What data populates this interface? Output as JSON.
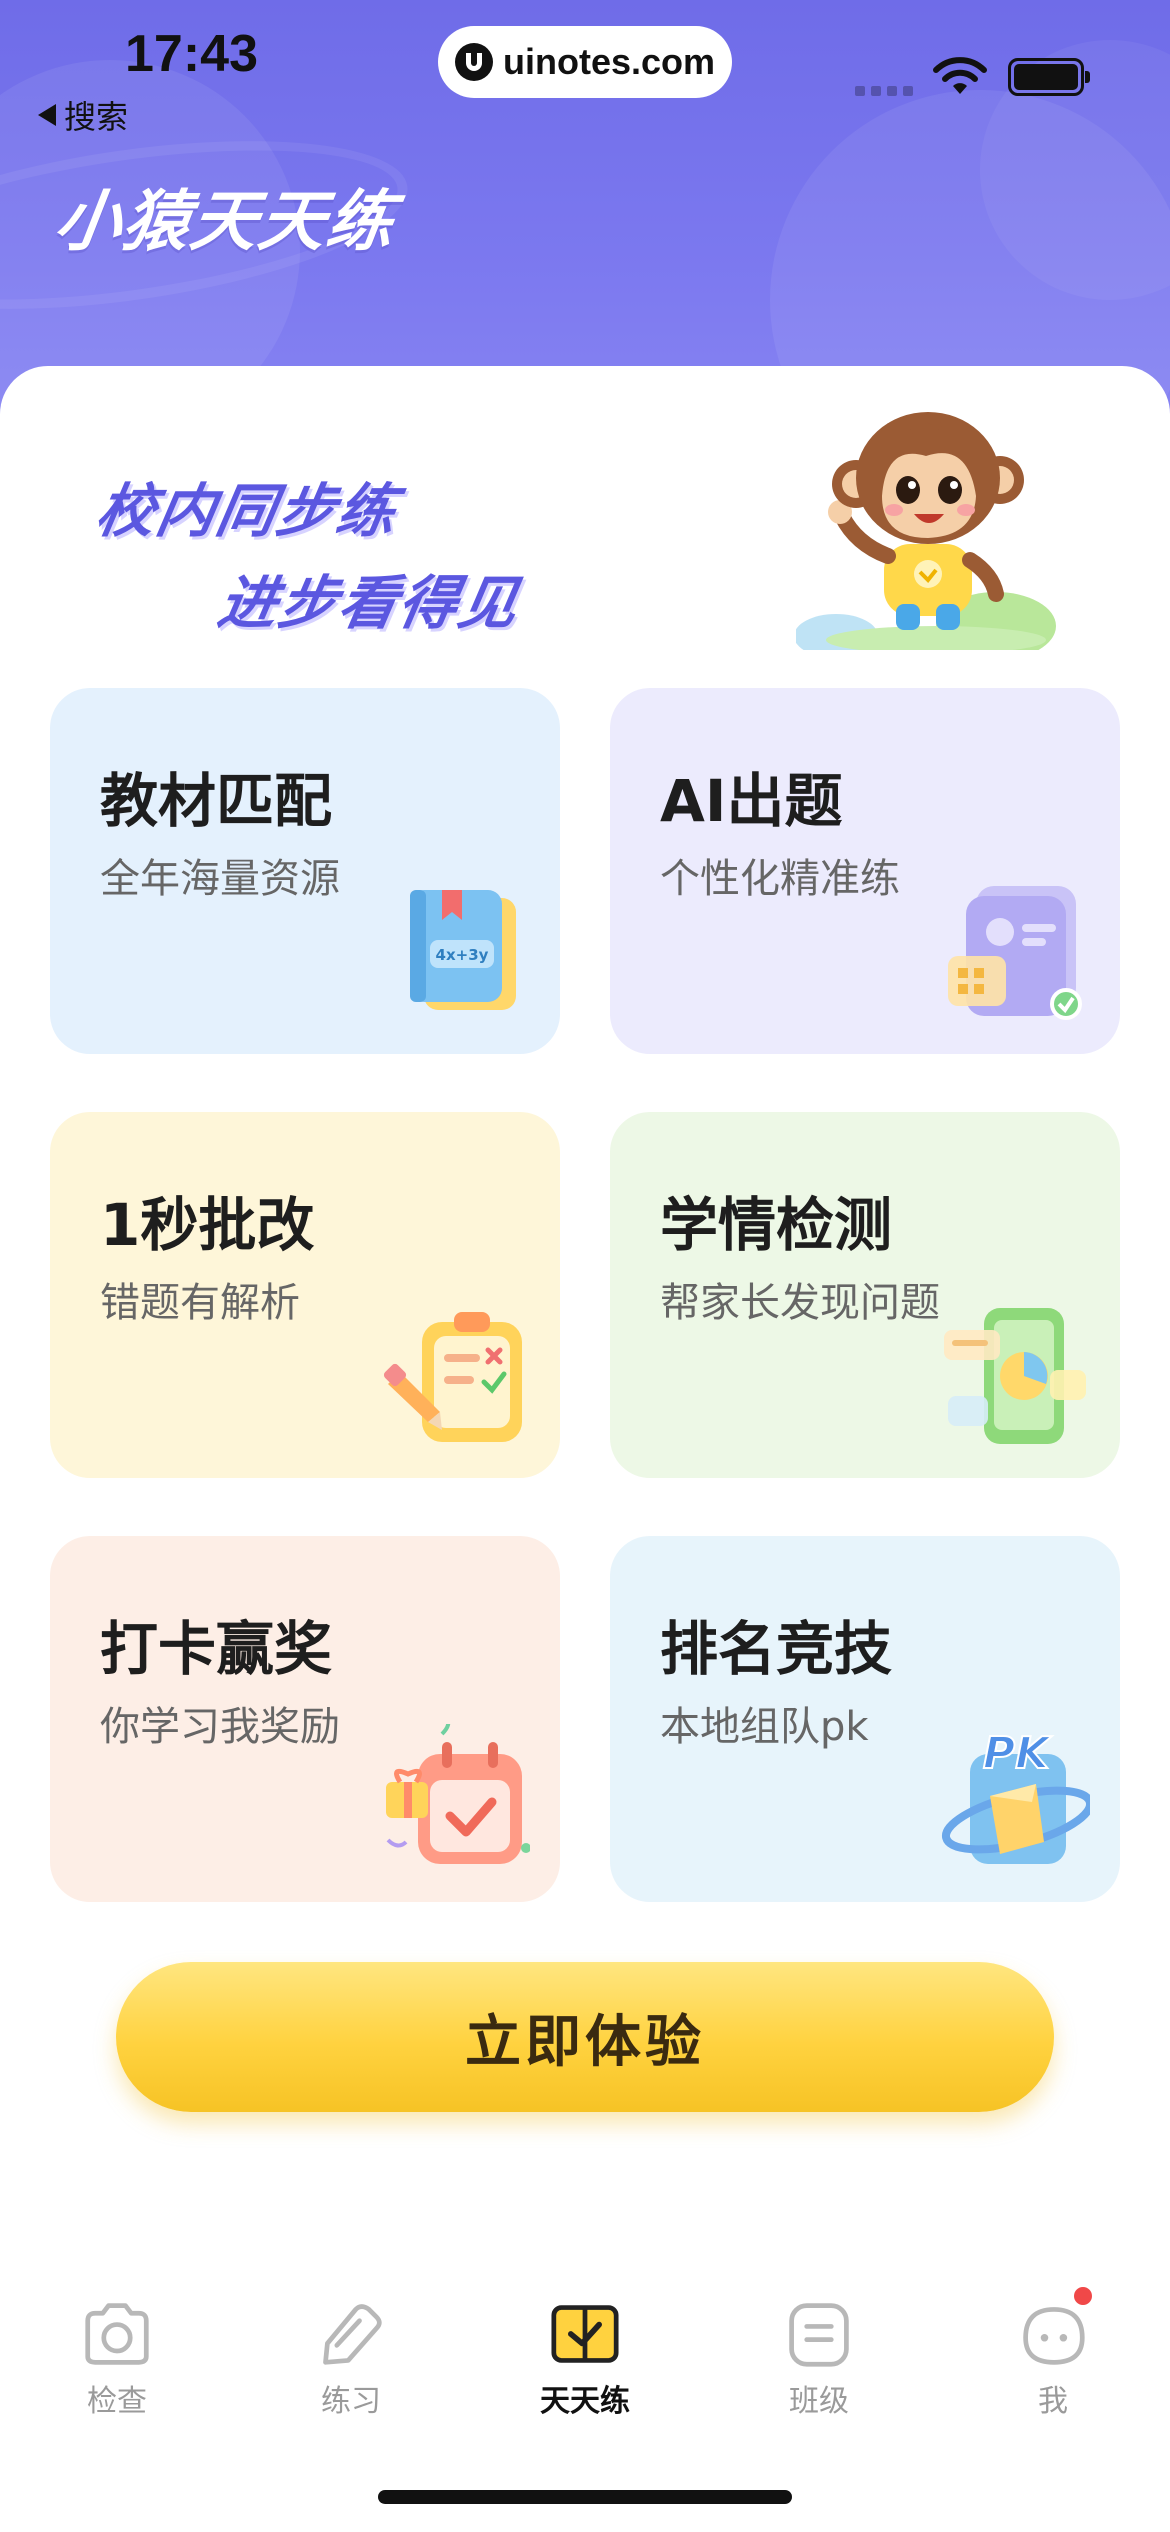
{
  "status_bar": {
    "time": "17:43",
    "back_label": "搜索",
    "url": "uinotes.com"
  },
  "header": {
    "app_title": "小猿天天练"
  },
  "banner": {
    "slogan_line1": "校内同步练",
    "slogan_line2": "进步看得见"
  },
  "cards": [
    {
      "title": "教材匹配",
      "subtitle": "全年海量资源",
      "bg": "#e4f1fd",
      "icon": "textbook-icon"
    },
    {
      "title": "AI出题",
      "subtitle": "个性化精准练",
      "bg": "#ecebfd",
      "icon": "ai-document-icon"
    },
    {
      "title": "1秒批改",
      "subtitle": "错题有解析",
      "bg": "#fef6d9",
      "icon": "clipboard-check-icon"
    },
    {
      "title": "学情检测",
      "subtitle": "帮家长发现问题",
      "bg": "#edf8e6",
      "icon": "phone-chart-icon"
    },
    {
      "title": "打卡赢奖",
      "subtitle": "你学习我奖励",
      "bg": "#fdeee6",
      "icon": "calendar-gift-icon"
    },
    {
      "title": "排名竞技",
      "subtitle": "本地组队pk",
      "bg": "#e7f4fb",
      "icon": "pk-globe-icon"
    }
  ],
  "cta": {
    "label": "立即体验"
  },
  "tabbar": {
    "items": [
      {
        "label": "检查",
        "icon": "camera-icon",
        "active": false
      },
      {
        "label": "练习",
        "icon": "pencil-tag-icon",
        "active": false
      },
      {
        "label": "天天练",
        "icon": "book-check-icon",
        "active": true
      },
      {
        "label": "班级",
        "icon": "class-list-icon",
        "active": false
      },
      {
        "label": "我",
        "icon": "face-icon",
        "active": false,
        "badge": true
      }
    ]
  },
  "colors": {
    "header_bg": "#716eea",
    "accent_purple": "#5b57e0",
    "cta_yellow": "#ffd23f",
    "badge_red": "#f04848"
  }
}
